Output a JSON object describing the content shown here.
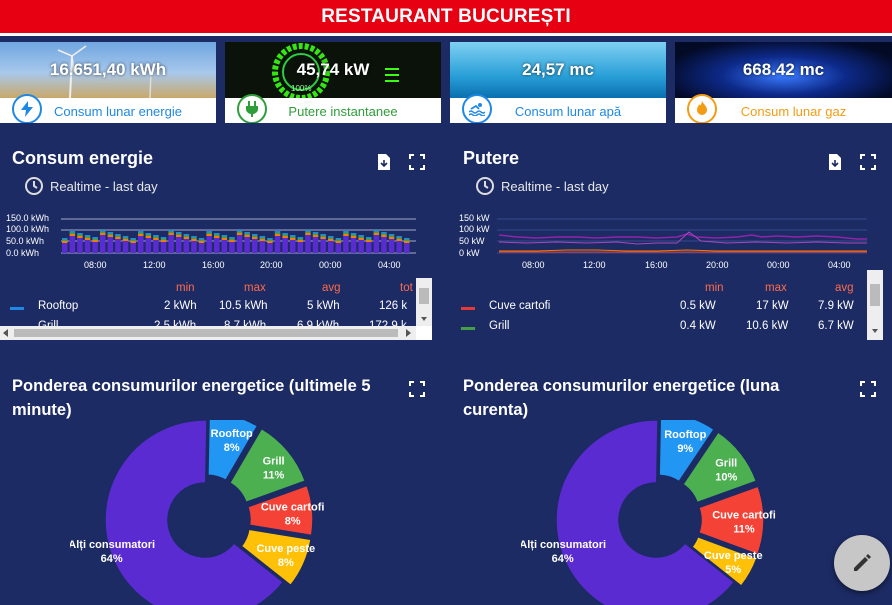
{
  "header": {
    "title": "RESTAURANT BUCUREȘTI"
  },
  "kpis": [
    {
      "value": "16.651,40 kWh",
      "label": "Consum lunar energie",
      "color": "#1e88e5",
      "icon": "lightning-icon"
    },
    {
      "value": "45,74 kW",
      "label": "Putere instantanee",
      "color": "#2e9e3a",
      "icon": "plug-icon",
      "inner": "100%"
    },
    {
      "value": "24,57 mc",
      "label": "Consum lunar apă",
      "color": "#1e88e5",
      "icon": "swimmer-icon"
    },
    {
      "value": "668.42 mc",
      "label": "Consum lunar gaz",
      "color": "#f39c12",
      "icon": "flame-icon"
    }
  ],
  "energy": {
    "title": "Consum energie",
    "subtitle": "Realtime - last day",
    "yticks": [
      "150.0 kWh",
      "100.0 kWh",
      "50.0 kWh",
      "0.0 kWh"
    ],
    "xticks": [
      "08:00",
      "12:00",
      "16:00",
      "20:00",
      "00:00",
      "04:00"
    ],
    "legend_headers": [
      "min",
      "max",
      "avg",
      "tot"
    ],
    "legend_rows": [
      {
        "name": "Rooftop",
        "color": "#1e88e5",
        "min": "2 kWh",
        "max": "10.5 kWh",
        "avg": "5 kWh",
        "tot": "126 k"
      },
      {
        "name": "Grill",
        "color": "#43a047",
        "min": "2.5 kWh",
        "max": "8.7 kWh",
        "avg": "6.9 kWh",
        "tot": "172.9 k"
      }
    ]
  },
  "power": {
    "title": "Putere",
    "subtitle": "Realtime - last day",
    "yticks": [
      "150 kW",
      "100 kW",
      "50 kW",
      "0 kW"
    ],
    "xticks": [
      "08:00",
      "12:00",
      "16:00",
      "20:00",
      "00:00",
      "04:00"
    ],
    "legend_headers": [
      "min",
      "max",
      "avg"
    ],
    "legend_rows": [
      {
        "name": "Cuve cartofi",
        "color": "#e53935",
        "min": "0.5 kW",
        "max": "17 kW",
        "avg": "7.9 kW"
      },
      {
        "name": "Grill",
        "color": "#43a047",
        "min": "0.4 kW",
        "max": "10.6 kW",
        "avg": "6.7 kW"
      }
    ]
  },
  "share5": {
    "title": "Ponderea consumurilor energetice (ultimele 5 minute)",
    "slices": [
      {
        "name": "Rooftop",
        "pct": "8%",
        "value": 8,
        "color": "#2196f3"
      },
      {
        "name": "Grill",
        "pct": "11%",
        "value": 11,
        "color": "#4caf50"
      },
      {
        "name": "Cuve cartofi",
        "pct": "8%",
        "value": 8,
        "color": "#f44336"
      },
      {
        "name": "Cuve peste",
        "pct": "8%",
        "value": 8,
        "color": "#ffc107"
      },
      {
        "name": "Alți consumatori",
        "pct": "64%",
        "value": 64,
        "color": "#5a2bd0"
      }
    ]
  },
  "shareMonth": {
    "title": "Ponderea consumurilor energetice (luna curenta)",
    "slices": [
      {
        "name": "Rooftop",
        "pct": "9%",
        "value": 9,
        "color": "#2196f3"
      },
      {
        "name": "Grill",
        "pct": "10%",
        "value": 10,
        "color": "#4caf50"
      },
      {
        "name": "Cuve cartofi",
        "pct": "11%",
        "value": 11,
        "color": "#f44336"
      },
      {
        "name": "Cuve peste",
        "pct": "5%",
        "value": 5,
        "color": "#ffc107"
      },
      {
        "name": "Alți consumatori",
        "pct": "64%",
        "value": 64,
        "color": "#5a2bd0"
      }
    ]
  }
}
